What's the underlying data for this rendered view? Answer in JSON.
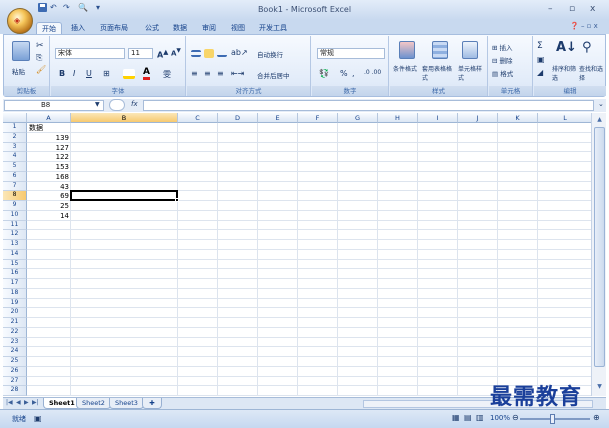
{
  "window": {
    "title": "Book1 - Microsoft Excel",
    "controls": {
      "minimize": "–",
      "maximize": "▫",
      "close": "x"
    },
    "qat_items": [
      "save-icon",
      "undo-icon",
      "redo-icon",
      "print-preview-icon",
      "customize-icon"
    ]
  },
  "office_button": {
    "label": "Office"
  },
  "tabs": [
    "开始",
    "插入",
    "页面布局",
    "公式",
    "数据",
    "审阅",
    "视图",
    "开发工具"
  ],
  "ribbon": {
    "clipboard": {
      "paste": "粘贴",
      "label": "剪贴板"
    },
    "font": {
      "name": "宋体",
      "size": "11",
      "bold": "B",
      "italic": "I",
      "underline": "U",
      "label": "字体"
    },
    "alignment": {
      "wrap_text": "自动换行",
      "merge_center": "合并后居中",
      "label": "对齐方式"
    },
    "number": {
      "format": "常规",
      "percent": "%",
      "comma": ",",
      "label": "数字"
    },
    "styles": {
      "conditional": "条件格式",
      "table": "套用表格格式",
      "cell_styles": "单元格样式",
      "label": "样式"
    },
    "cells": {
      "insert": "插入",
      "delete": "删除",
      "format": "格式",
      "label": "单元格"
    },
    "editing": {
      "sum": "Σ",
      "sort_filter": "排序和筛选",
      "find_select": "查找和选择",
      "label": "编辑"
    }
  },
  "formula_bar": {
    "name_box": "B8",
    "fx": "fx",
    "formula": ""
  },
  "grid": {
    "columns": [
      "A",
      "B",
      "C",
      "D",
      "E",
      "F",
      "G",
      "H",
      "I",
      "J",
      "K",
      "L"
    ],
    "rows": [
      "1",
      "2",
      "3",
      "4",
      "5",
      "6",
      "7",
      "8",
      "9",
      "10",
      "11",
      "12",
      "13",
      "14",
      "15",
      "16",
      "17",
      "18",
      "19",
      "20",
      "21",
      "22",
      "23",
      "24",
      "25",
      "26",
      "27",
      "28"
    ],
    "cells": {
      "A1": "数据",
      "A2": "139",
      "A3": "127",
      "A4": "122",
      "A5": "153",
      "A6": "168",
      "A7": "43",
      "A8": "69",
      "A9": "25",
      "A10": "14"
    },
    "active_cell": "B8"
  },
  "sheets": [
    "Sheet1",
    "Sheet2",
    "Sheet3"
  ],
  "active_sheet": "Sheet1",
  "status": {
    "ready": "就绪",
    "zoom": "100%"
  },
  "watermark": "最需教育",
  "colors": {
    "accent": "#15428b",
    "ribbon_bg": "#dbe7f7",
    "selected_header": "#f7c96f"
  }
}
